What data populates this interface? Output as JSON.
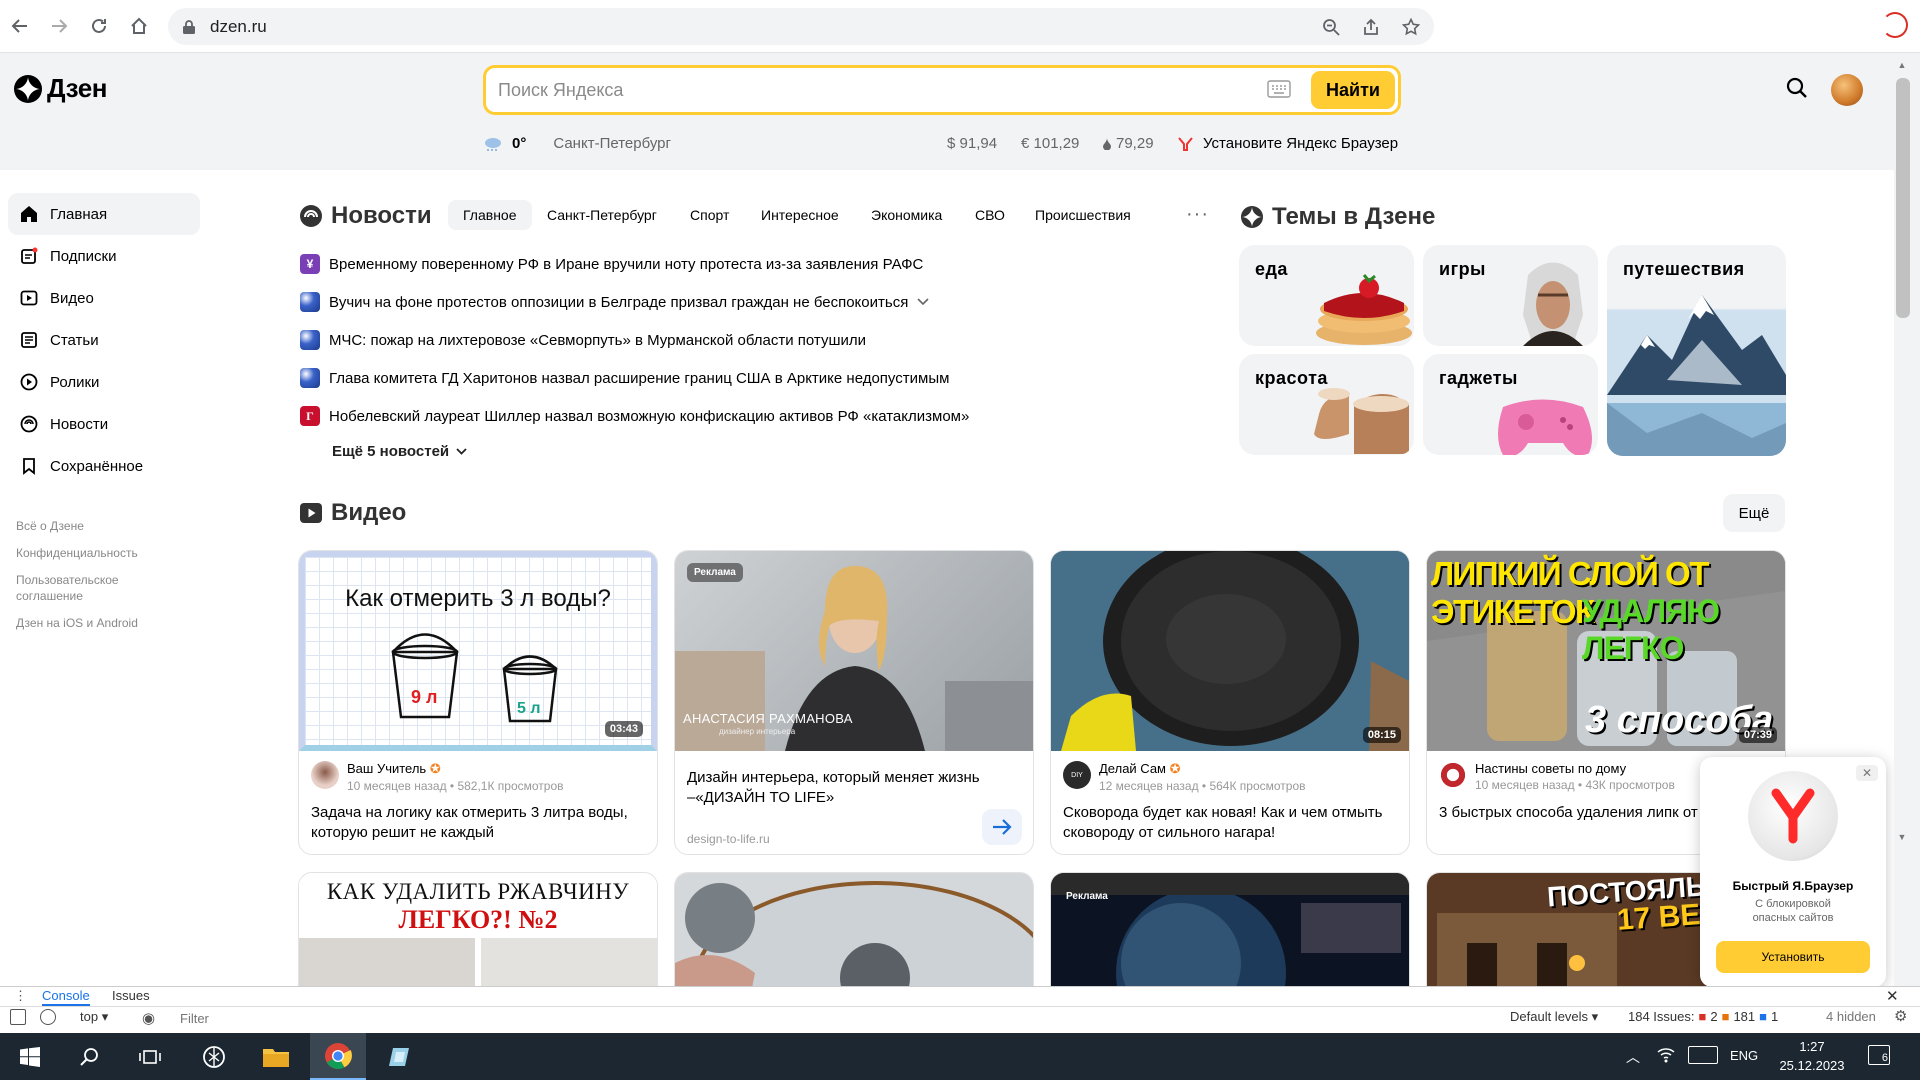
{
  "browser": {
    "url": "dzen.ru"
  },
  "header": {
    "logo_text": "Дзен",
    "search_placeholder": "Поиск Яндекса",
    "search_button": "Найти",
    "weather_temp": "0°",
    "city": "Санкт-Петербург",
    "usd": "$ 91,94",
    "eur": "€ 101,29",
    "oil": "79,29",
    "browser_promo": "Установите Яндекс Браузер"
  },
  "sidebar": {
    "items": [
      {
        "label": "Главная",
        "icon": "home-icon"
      },
      {
        "label": "Подписки",
        "icon": "subscriptions-icon"
      },
      {
        "label": "Видео",
        "icon": "video-icon"
      },
      {
        "label": "Статьи",
        "icon": "articles-icon"
      },
      {
        "label": "Ролики",
        "icon": "shorts-icon"
      },
      {
        "label": "Новости",
        "icon": "news-icon"
      },
      {
        "label": "Сохранённое",
        "icon": "bookmark-icon"
      }
    ],
    "links": [
      "Всё о Дзене",
      "Конфиденциальность",
      "Пользовательское соглашение",
      "Дзен на iOS и Android"
    ]
  },
  "news": {
    "title": "Новости",
    "tabs": [
      "Главное",
      "Санкт-Петербург",
      "Спорт",
      "Интересное",
      "Экономика",
      "СВО",
      "Происшествия"
    ],
    "items": [
      "Временному поверенному РФ в Иране вручили ноту протеста из-за заявления РАФС",
      "Вучич на фоне протестов оппозиции в Белграде призвал граждан не беспокоиться",
      "МЧС: пожар на лихтеровозе «Севморпуть» в Мурманской области потушили",
      "Глава комитета ГД Харитонов назвал расширение границ США в Арктике недопустимым",
      "Нобелевский лауреат Шиллер назвал возможную конфискацию активов РФ «катаклизмом»"
    ],
    "more": "Ещё 5 новостей"
  },
  "topics": {
    "title": "Темы в Дзене",
    "items": [
      "еда",
      "игры",
      "путешествия",
      "красота",
      "гаджеты"
    ]
  },
  "video": {
    "title": "Видео",
    "more": "Ещё",
    "cards": [
      {
        "thumb_text": "Как отмерить 3 л воды?",
        "bucket1": "9 л",
        "bucket2": "5 л",
        "duration": "03:43",
        "channel": "Ваш Учитель",
        "meta": "10 месяцев назад • 582,1К просмотров",
        "title": "Задача на логику как отмерить 3 литра воды, которую решит не каждый"
      },
      {
        "ad": "Реклама",
        "caption_name": "АНАСТАСИЯ РАХМАНОВА",
        "caption_role": "дизайнер интерьера",
        "title": "Дизайн интерьера, который меняет жизнь –«ДИЗАЙН TO LIFE»",
        "domain": "design-to-life.ru"
      },
      {
        "duration": "08:15",
        "channel": "Делай Сам",
        "meta": "12 месяцев назад • 564К просмотров",
        "title": "Сковорода будет как новая! Как и чем отмыть сковороду от сильного нагара!"
      },
      {
        "thumb_line1": "ЛИПКИЙ СЛОЙ ОТ ЭТИКЕТОК",
        "thumb_line2": "УДАЛЯЮ ЛЕГКО",
        "thumb_line3": "3 способа",
        "duration": "07:39",
        "channel": "Настины советы по дому",
        "meta": "10 месяцев назад • 43К просмотров",
        "title": "3 быстрых способа удаления липк от этикеток на банках, НАКЛЕЕК и"
      }
    ],
    "row2": {
      "card1_line1": "КАК УДАЛИТЬ РЖАВЧИНУ",
      "card1_line2": "ЛЕГКО?! №2",
      "card3_ad": "Реклама",
      "card4_line1": "ПОСТОЯЛЫЙ",
      "card4_line2": "17 ВЕ"
    }
  },
  "promo_popup": {
    "title": "Быстрый Я.Браузер",
    "subtitle": "С блокировкой опасных сайтов",
    "button": "Установить"
  },
  "devtools": {
    "tabs": [
      "Console",
      "Issues"
    ],
    "context": "top",
    "filter_placeholder": "Filter",
    "levels": "Default levels",
    "issues": "184 Issues:",
    "red": "2",
    "orange": "181",
    "blue": "1",
    "hidden": "4 hidden"
  },
  "taskbar": {
    "lang": "ENG",
    "time": "1:27",
    "date": "25.12.2023",
    "notif": "6"
  },
  "colors": {
    "accent": "#ffcc33",
    "link": "#0077ff"
  }
}
